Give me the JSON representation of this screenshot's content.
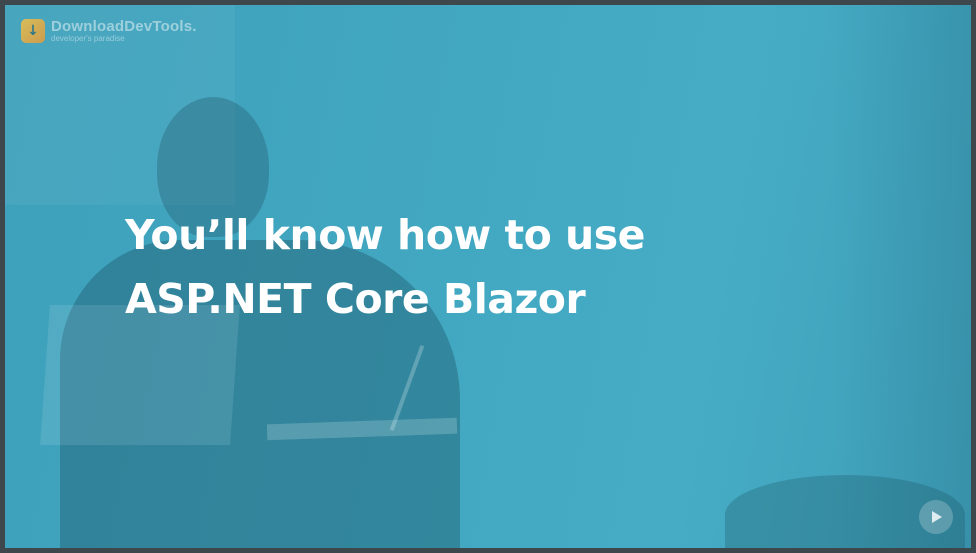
{
  "watermark": {
    "name": "DownloadDevTools.",
    "tagline": "developer's paradise",
    "icon": "download-logo-icon",
    "accent": "#f0c24a"
  },
  "slide": {
    "headline_line1": "You’ll know how to use",
    "headline_line2": "ASP.NET Core Blazor",
    "background_color": "#42a7c1",
    "text_color": "#ffffff"
  },
  "player": {
    "badge_icon": "play-logo-icon"
  }
}
